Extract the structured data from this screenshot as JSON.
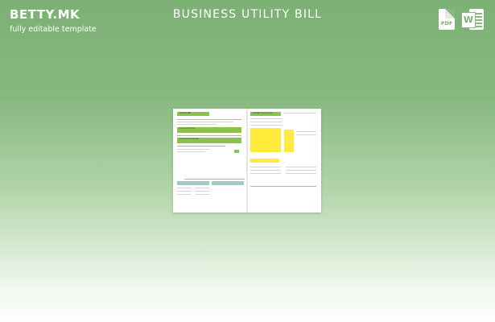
{
  "brand": {
    "name": "BETTY.MK",
    "tagline": "fully editable template"
  },
  "page_title": "BUSINESS UTILITY BILL",
  "formats": [
    "PDF",
    "W"
  ],
  "colors": {
    "accent_green": "#8bc34a",
    "accent_teal": "#9acfc7",
    "highlight_yellow": "#ffeb3b"
  },
  "preview": {
    "left_page": {
      "header": "Utility Bill",
      "section_2": "Amount Due",
      "section_3": "Service Address"
    },
    "right_page": {
      "header": "Usage Summary"
    }
  }
}
